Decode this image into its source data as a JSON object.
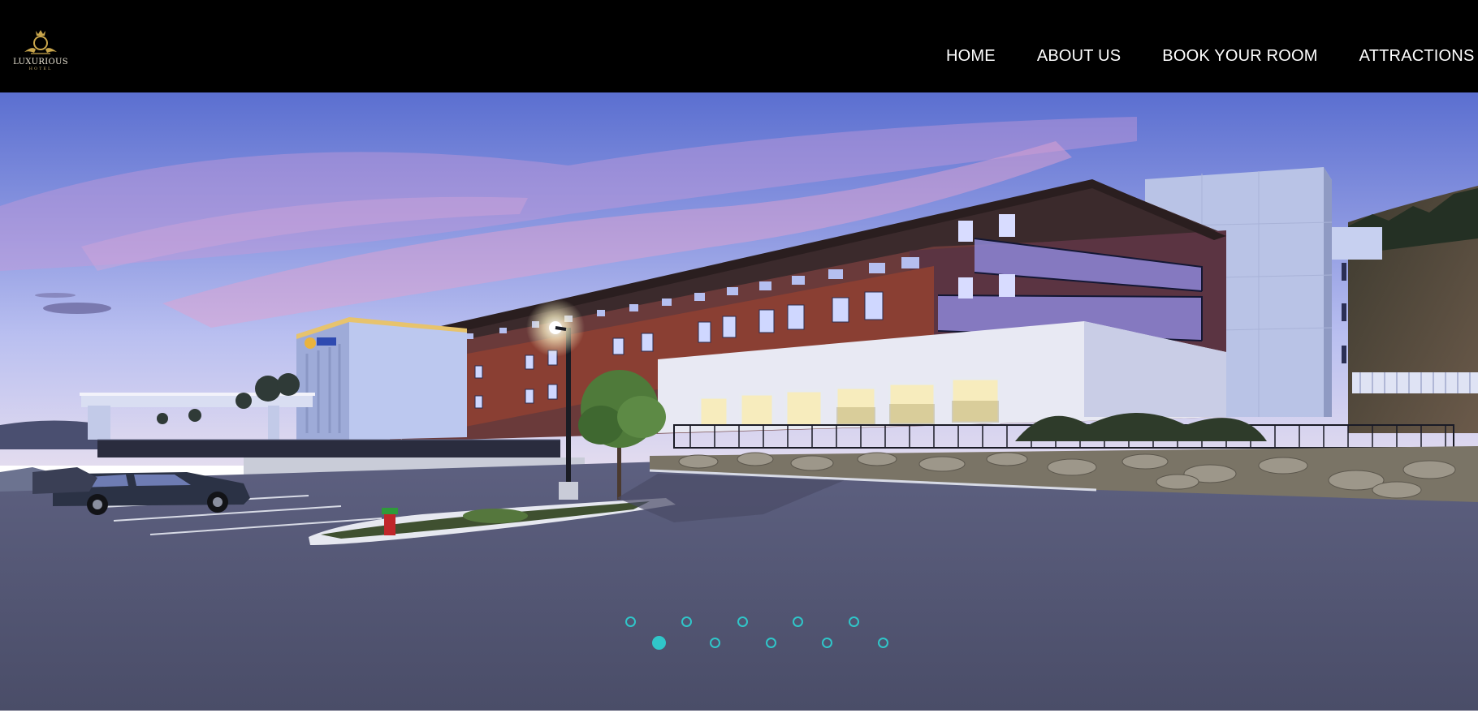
{
  "brand": {
    "name": "LUXURIOUS",
    "tagline": "HOTEL",
    "accent_color": "#c9a64c"
  },
  "nav": {
    "items": [
      {
        "label": "HOME"
      },
      {
        "label": "ABOUT US"
      },
      {
        "label": "BOOK YOUR ROOM"
      },
      {
        "label": "ATTRACTIONS"
      }
    ]
  },
  "hero": {
    "image_description_icon": "hotel-photo",
    "carousel": {
      "total_slides": 10,
      "active_index": 0,
      "indicator_color": "#30c6c9"
    }
  }
}
